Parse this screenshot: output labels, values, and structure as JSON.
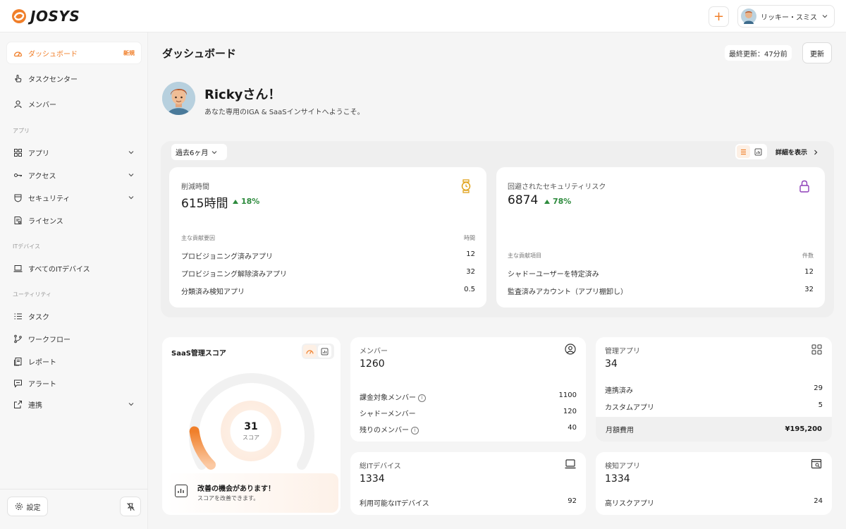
{
  "app": {
    "logo_text": "JOSYS"
  },
  "header": {
    "plus_label": "+",
    "user_name": "リッキー・スミス"
  },
  "sidebar": {
    "items_top": [
      {
        "label": "ダッシュボード",
        "badge": "新規",
        "icon": "dashboard-icon",
        "active": true
      },
      {
        "label": "タスクセンター",
        "icon": "hand-pointer-icon"
      },
      {
        "label": "メンバー",
        "icon": "person-icon"
      }
    ],
    "section_apps": "アプリ",
    "items_apps": [
      {
        "label": "アプリ",
        "icon": "grid-icon"
      },
      {
        "label": "アクセス",
        "icon": "key-icon"
      },
      {
        "label": "セキュリティ",
        "icon": "shield-icon"
      },
      {
        "label": "ライセンス",
        "icon": "license-icon"
      }
    ],
    "section_devices": "ITデバイス",
    "items_devices": [
      {
        "label": "すべてのITデバイス",
        "icon": "laptop-icon"
      }
    ],
    "section_utility": "ユーティリティ",
    "items_utility": [
      {
        "label": "タスク",
        "icon": "list-icon"
      },
      {
        "label": "ワークフロー",
        "icon": "workflow-icon"
      },
      {
        "label": "レポート",
        "icon": "report-icon"
      },
      {
        "label": "アラート",
        "icon": "chat-icon"
      },
      {
        "label": "連携",
        "icon": "integration-icon"
      }
    ],
    "settings_label": "設定"
  },
  "main": {
    "title": "ダッシュボード",
    "last_updated": "最終更新：47分前",
    "refresh_label": "更新",
    "greeting_title": "Rickyさん！",
    "greeting_sub": "あなた専用のIGA & SaaSインサイトへようこそ。",
    "period": "過去6ヶ月",
    "details_label": "詳細を表示"
  },
  "time_saved": {
    "label": "削減時間",
    "value": "615時間",
    "delta": "18%",
    "col_left": "主な貢献要因",
    "col_right": "時間",
    "rows": [
      {
        "label": "プロビジョニング済みアプリ",
        "value": "12"
      },
      {
        "label": "プロビジョニング解除済みアプリ",
        "value": "32"
      },
      {
        "label": "分類済み検知アプリ",
        "value": "0.5"
      }
    ]
  },
  "risk_avoided": {
    "label": "回避されたセキュリティリスク",
    "value": "6874",
    "delta": "78%",
    "col_left": "主な貢献項目",
    "col_right": "件数",
    "rows": [
      {
        "label": "シャドーユーザーを特定済み",
        "value": "12"
      },
      {
        "label": "監査済みアカウント（アプリ棚卸し）",
        "value": "32"
      }
    ]
  },
  "score": {
    "title": "SaaS管理スコア",
    "value": "31",
    "value_label": "スコア",
    "fraction": 0.31,
    "improve_title": "改善の機会があります！",
    "improve_sub": "スコアを改善できます。"
  },
  "members": {
    "label": "メンバー",
    "value": "1260",
    "rows": [
      {
        "label": "課金対象メンバー",
        "value": "1100",
        "info": true
      },
      {
        "label": "シャドーメンバー",
        "value": "120",
        "info": false
      },
      {
        "label": "残りのメンバー",
        "value": "40",
        "info": true
      }
    ]
  },
  "managed_apps": {
    "label": "管理アプリ",
    "value": "34",
    "rows": [
      {
        "label": "連携済み",
        "value": "29"
      },
      {
        "label": "カスタムアプリ",
        "value": "5"
      }
    ],
    "monthly_label": "月額費用",
    "monthly_value": "¥195,200"
  },
  "devices": {
    "label": "総ITデバイス",
    "value": "1334",
    "row_label": "利用可能なITデバイス",
    "row_value": "92"
  },
  "detected_apps": {
    "label": "検知アプリ",
    "value": "1334",
    "row_label": "高リスクアプリ",
    "row_value": "24"
  },
  "colors": {
    "accent": "#f07f2a",
    "positive": "#2e8b3e",
    "risk_icon": "#8e3fb8",
    "time_icon": "#e0a21a"
  }
}
